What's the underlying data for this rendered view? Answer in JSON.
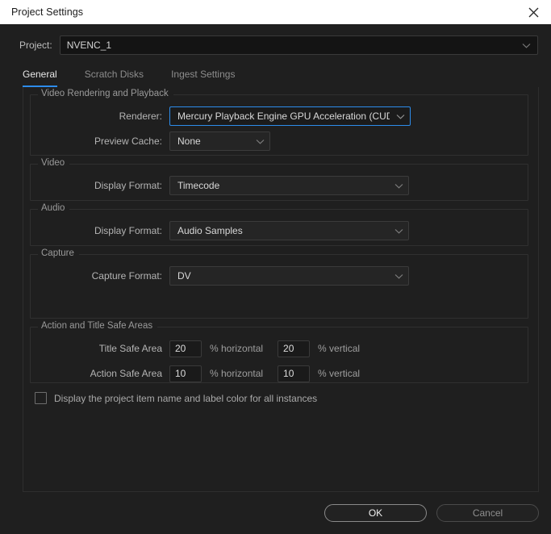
{
  "window": {
    "title": "Project Settings",
    "close_icon": "close-icon"
  },
  "project": {
    "label": "Project:",
    "value": "NVENC_1",
    "dropdown_icon": "chevron-down-icon"
  },
  "tabs": [
    {
      "label": "General",
      "active": true
    },
    {
      "label": "Scratch Disks",
      "active": false
    },
    {
      "label": "Ingest Settings",
      "active": false
    }
  ],
  "groups": {
    "video_rendering": {
      "legend": "Video Rendering and Playback",
      "renderer": {
        "label": "Renderer:",
        "value": "Mercury Playback Engine GPU Acceleration (CUDA)"
      },
      "preview_cache": {
        "label": "Preview Cache:",
        "value": "None"
      }
    },
    "video": {
      "legend": "Video",
      "display_format": {
        "label": "Display Format:",
        "value": "Timecode"
      }
    },
    "audio": {
      "legend": "Audio",
      "display_format": {
        "label": "Display Format:",
        "value": "Audio Samples"
      }
    },
    "capture": {
      "legend": "Capture",
      "capture_format": {
        "label": "Capture Format:",
        "value": "DV"
      }
    },
    "safe_areas": {
      "legend": "Action and Title Safe Areas",
      "title_safe": {
        "label": "Title Safe Area",
        "horizontal": "20",
        "vertical": "20",
        "horizontal_unit": "% horizontal",
        "vertical_unit": "% vertical"
      },
      "action_safe": {
        "label": "Action Safe Area",
        "horizontal": "10",
        "vertical": "10",
        "horizontal_unit": "% horizontal",
        "vertical_unit": "% vertical"
      }
    }
  },
  "display_option": {
    "label": "Display the project item name and label color for all instances",
    "checked": false
  },
  "footer": {
    "ok_label": "OK",
    "cancel_label": "Cancel"
  },
  "colors": {
    "accent": "#2d8ceb",
    "titlebar_bg": "#ffffff",
    "dialog_bg": "#1f1f1f"
  }
}
